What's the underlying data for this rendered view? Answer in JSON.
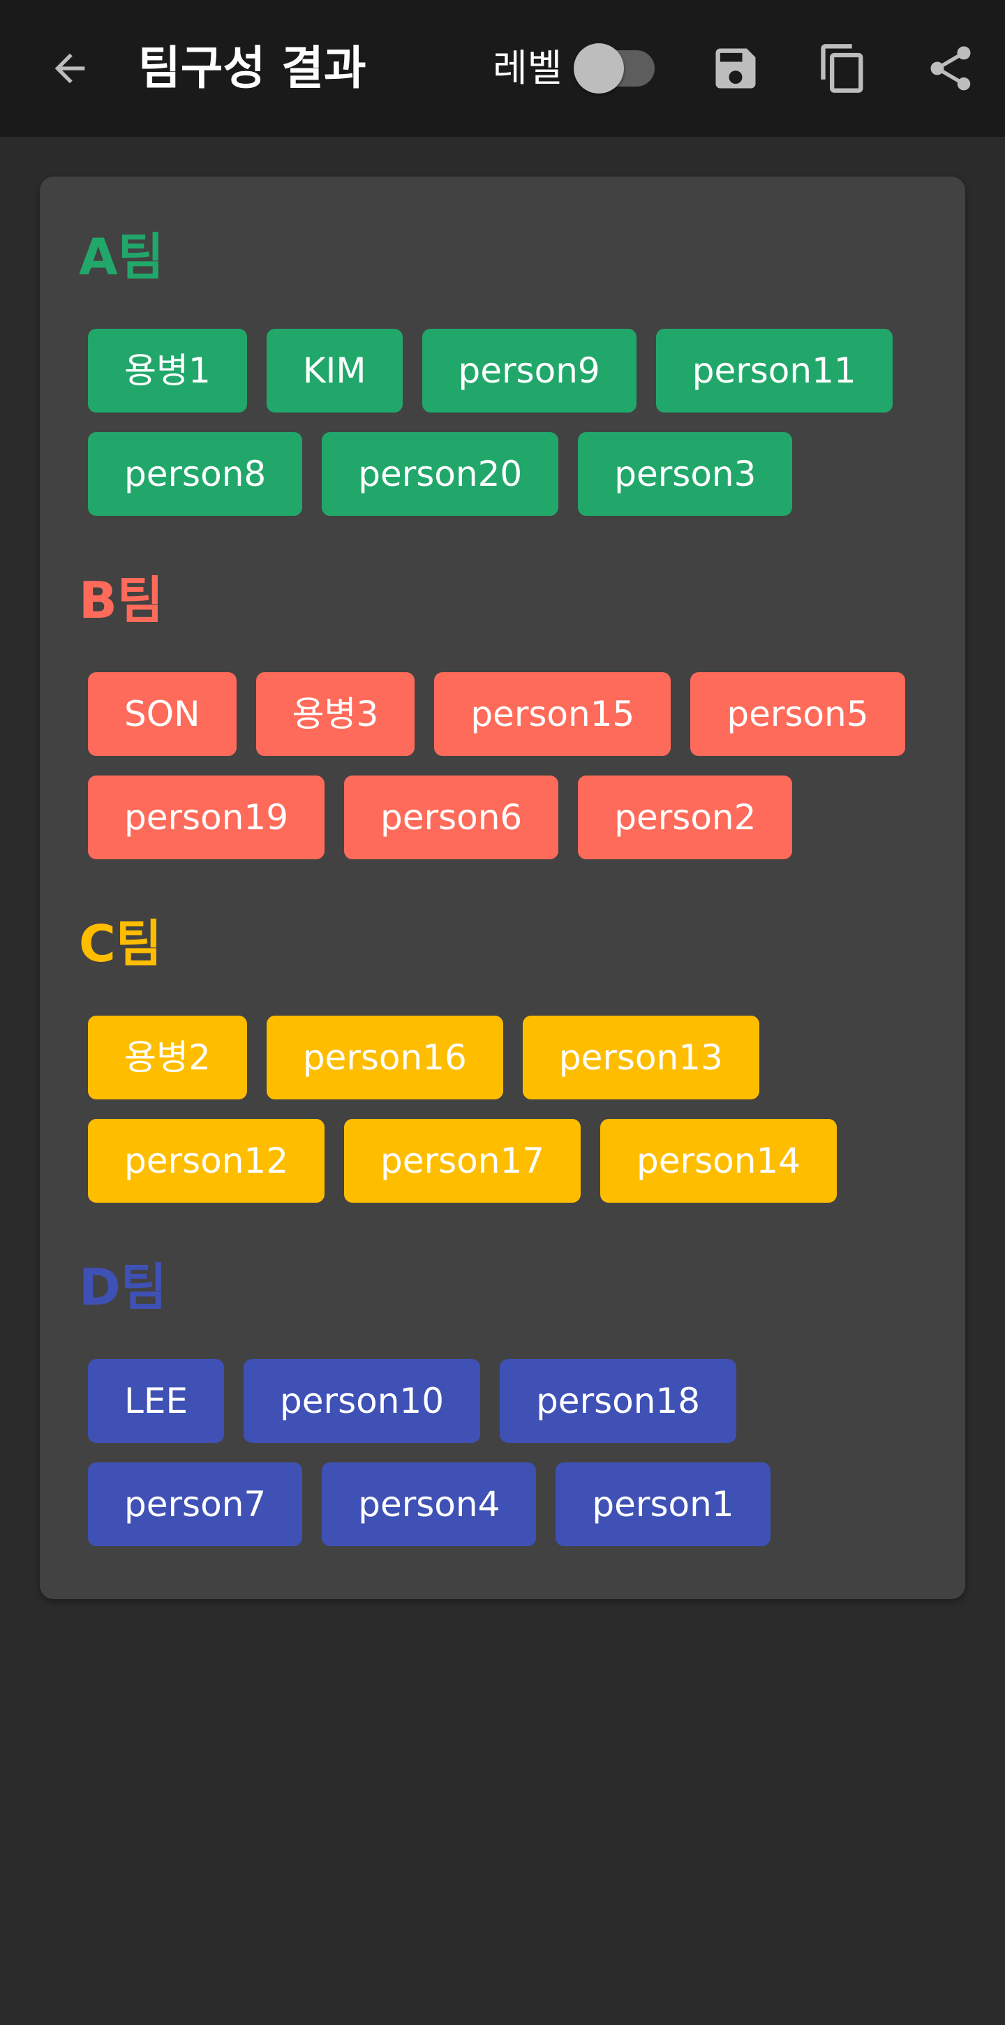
{
  "appbar": {
    "title": "팀구성 결과",
    "level_label": "레벨",
    "level_toggle_on": false,
    "icons": {
      "back": "arrow-left-icon",
      "save": "floppy-disk-icon",
      "copy": "copy-icon",
      "share": "share-icon"
    }
  },
  "colors": {
    "team_a": "#22a76b",
    "team_b": "#ff6b5a",
    "team_c": "#ffbd00",
    "team_d": "#3f51b5"
  },
  "teams": [
    {
      "name": "A팀",
      "members": [
        "용병1",
        "KIM",
        "person9",
        "person11",
        "person8",
        "person20",
        "person3"
      ]
    },
    {
      "name": "B팀",
      "members": [
        "SON",
        "용병3",
        "person15",
        "person5",
        "person19",
        "person6",
        "person2"
      ]
    },
    {
      "name": "C팀",
      "members": [
        "용병2",
        "person16",
        "person13",
        "person12",
        "person17",
        "person14"
      ]
    },
    {
      "name": "D팀",
      "members": [
        "LEE",
        "person10",
        "person18",
        "person7",
        "person4",
        "person1"
      ]
    }
  ]
}
